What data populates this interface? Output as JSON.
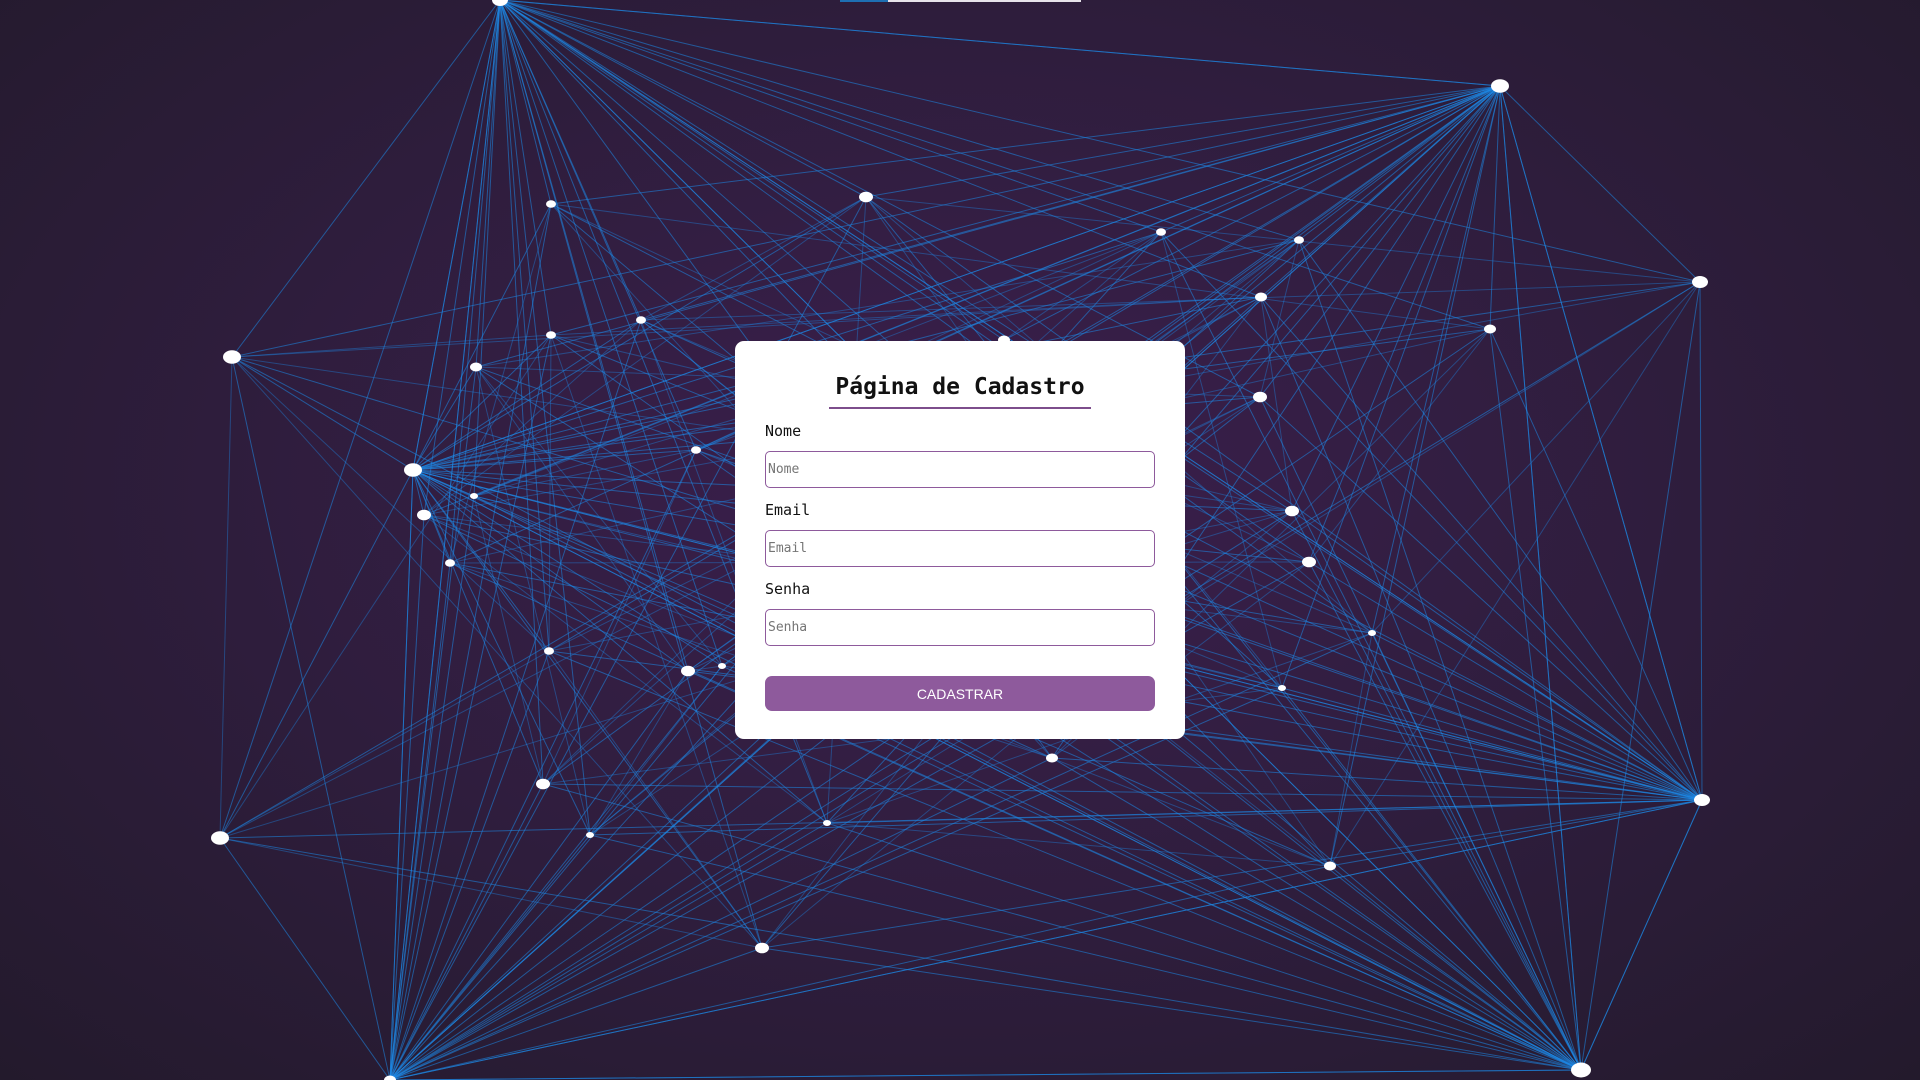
{
  "page": {
    "title": "Página de Cadastro"
  },
  "form": {
    "fields": [
      {
        "label": "Nome",
        "placeholder": "Nome",
        "type": "text"
      },
      {
        "label": "Email",
        "placeholder": "Email",
        "type": "email"
      },
      {
        "label": "Senha",
        "placeholder": "Senha",
        "type": "password"
      }
    ],
    "submit_label": "CADASTRAR"
  },
  "colors": {
    "background": "#2e1d3c",
    "accent": "#8e5a9c",
    "network_line": "#1e88e5",
    "network_node": "#ffffff"
  }
}
